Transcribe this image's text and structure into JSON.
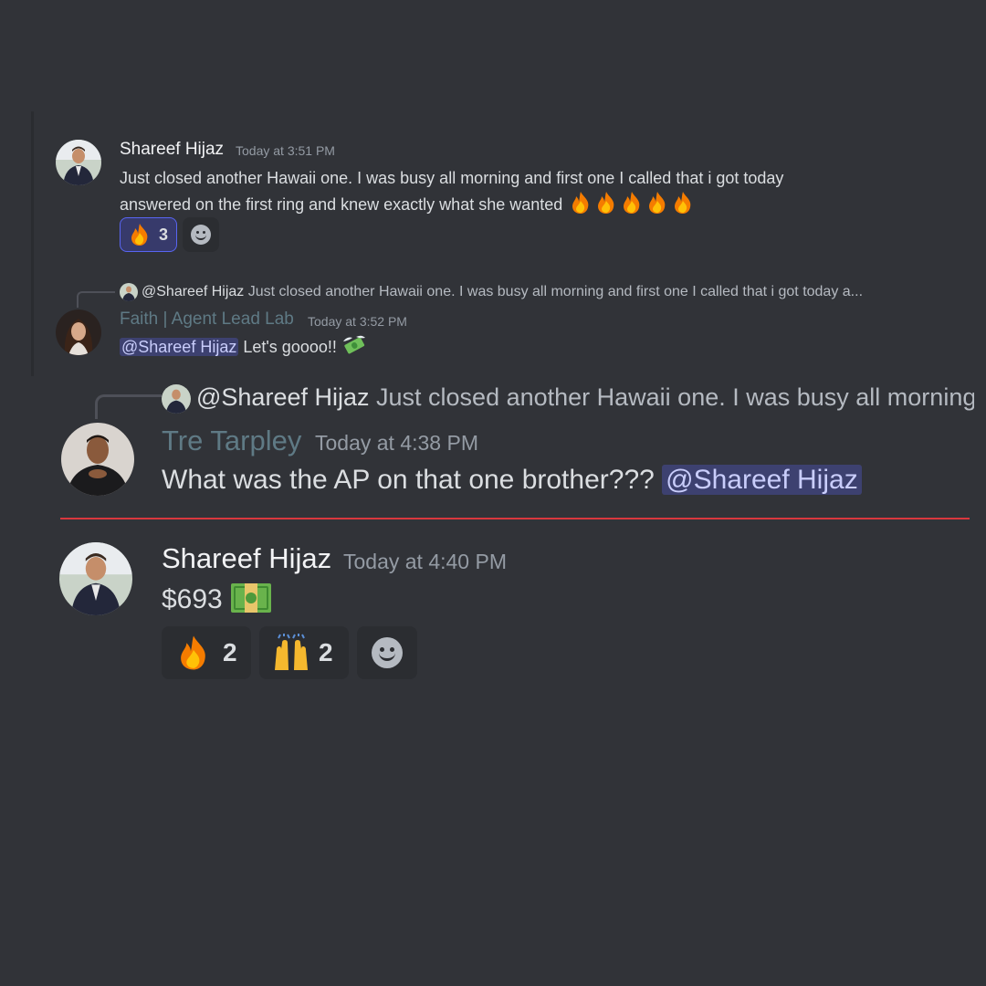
{
  "messages": [
    {
      "author": "Shareef Hijaz",
      "timestamp": "Today at 3:51 PM",
      "lines": [
        "Just closed another Hawaii one. I was busy all morning and first one I called that i got today",
        "answered on the first ring and knew exactly what she wanted"
      ],
      "trailing_emoji": "fire-icon x5",
      "reactions": [
        {
          "emoji": "fire-icon",
          "count": "3",
          "me": true
        }
      ]
    },
    {
      "reply_to": {
        "mention": "@Shareef Hijaz",
        "snippet": "Just closed another Hawaii one. I was busy all morning and first one I called that i got today a..."
      },
      "author": "Faith | Agent Lead Lab",
      "author_color": "#5f7a85",
      "timestamp": "Today at 3:52 PM",
      "mention": "@Shareef Hijaz",
      "text": "Let's goooo!!",
      "trailing_emoji": "money-with-wings-icon"
    },
    {
      "reply_to": {
        "mention": "@Shareef Hijaz",
        "snippet": "Just closed another Hawaii one. I was busy all morning"
      },
      "author": "Tre Tarpley",
      "author_color": "#5f7a85",
      "timestamp": "Today at 4:38 PM",
      "text": "What was the AP on that one brother???",
      "mention": "@Shareef Hijaz"
    },
    {
      "author": "Shareef Hijaz",
      "timestamp": "Today at 4:40 PM",
      "text": "$693",
      "trailing_emoji": "dollar-banknote-icon",
      "reactions": [
        {
          "emoji": "fire-icon",
          "count": "2",
          "me": false
        },
        {
          "emoji": "raising-hands-icon",
          "count": "2",
          "me": false
        }
      ]
    }
  ],
  "colors": {
    "background": "#313338",
    "mention_bg": "#3c4270",
    "new_messages_divider": "#d9373d"
  }
}
